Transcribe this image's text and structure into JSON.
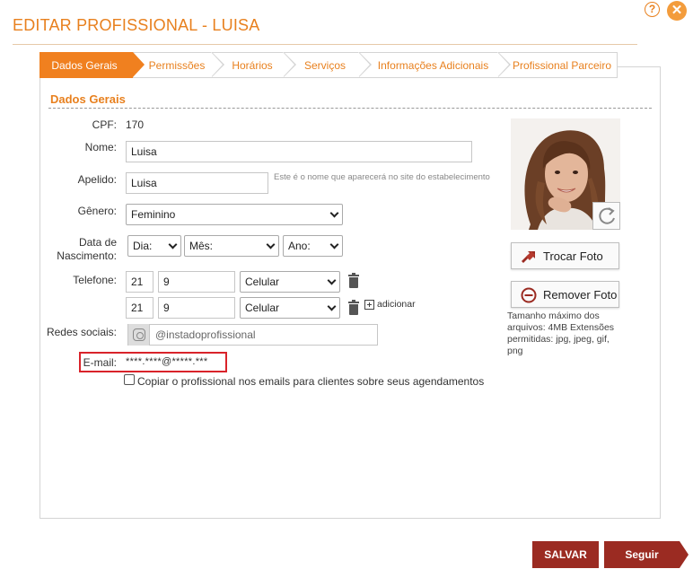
{
  "header": {
    "title": "EDITAR PROFISSIONAL - LUISA",
    "help_glyph": "?",
    "close_glyph": "✕"
  },
  "tabs": [
    {
      "label": "Dados Gerais",
      "active": true
    },
    {
      "label": "Permissões",
      "active": false
    },
    {
      "label": "Horários",
      "active": false
    },
    {
      "label": "Serviços",
      "active": false
    },
    {
      "label": "Informações Adicionais",
      "active": false
    },
    {
      "label": "Profissional Parceiro",
      "active": false
    }
  ],
  "section": {
    "title": "Dados Gerais"
  },
  "form": {
    "cpf": {
      "label": "CPF:",
      "value": "170"
    },
    "nome": {
      "label": "Nome:",
      "value": "Luisa"
    },
    "apelido": {
      "label": "Apelido:",
      "value": "Luisa",
      "hint": "Este é o nome que aparecerá no site do estabelecimento"
    },
    "genero": {
      "label": "Gênero:",
      "value": "Feminino"
    },
    "nascimento": {
      "label_line1": "Data de",
      "label_line2": "Nascimento:",
      "dia": "Dia:",
      "mes": "Mês:",
      "ano": "Ano:"
    },
    "telefone": {
      "label": "Telefone:",
      "rows": [
        {
          "ddd": "21",
          "numero": "9",
          "tipo": "Celular"
        },
        {
          "ddd": "21",
          "numero": "9",
          "tipo": "Celular"
        }
      ],
      "add_label": "adicionar"
    },
    "redes": {
      "label": "Redes sociais:",
      "placeholder": "@instadoprofissional",
      "icon": "instagram-icon"
    },
    "email": {
      "label": "E-mail:",
      "value": "****.****@*****.***"
    },
    "copiar": {
      "label": "Copiar o profissional nos emails para clientes sobre seus agendamentos",
      "checked": false
    }
  },
  "photo": {
    "change_label": "Trocar Foto",
    "remove_label": "Remover Foto",
    "note": "Tamanho máximo dos arquivos: 4MB Extensões permitidas: jpg, jpeg, gif, png"
  },
  "footer": {
    "save_label": "SALVAR",
    "next_label": "Seguir"
  },
  "colors": {
    "accent": "#f0801f",
    "dark_red": "#9b2b22",
    "highlight": "#d9232a"
  }
}
